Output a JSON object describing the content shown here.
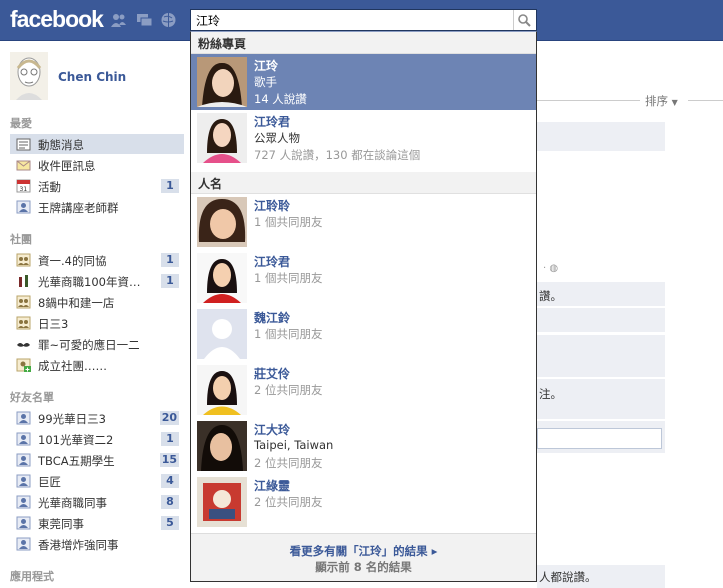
{
  "brand": {
    "logo": "facebook",
    "color": "#3b5998"
  },
  "topbar_icons": [
    "friend-requests-icon",
    "messages-icon",
    "notifications-icon"
  ],
  "search": {
    "value": "江玲",
    "icon": "search-icon"
  },
  "profile": {
    "name": "Chen Chin"
  },
  "sections": {
    "favorites": "最愛",
    "groups": "社團",
    "friend_lists": "好友名單",
    "apps": "應用程式"
  },
  "favorites": [
    {
      "label": "動態消息",
      "icon": "news-feed-icon",
      "count": ""
    },
    {
      "label": "收件匣訊息",
      "icon": "messages-icon",
      "count": ""
    },
    {
      "label": "活動",
      "icon": "calendar-icon",
      "count": "1"
    },
    {
      "label": "王牌講座老師群",
      "icon": "person-icon",
      "count": ""
    }
  ],
  "groups": [
    {
      "label": "資一.4的同協",
      "icon": "group-icon",
      "count": "1"
    },
    {
      "label": "光華商職100年資…",
      "icon": "wine-icon",
      "count": "1"
    },
    {
      "label": "8鍋中和建一店",
      "icon": "group-icon",
      "count": ""
    },
    {
      "label": "日三3",
      "icon": "group-icon",
      "count": ""
    },
    {
      "label": "罪~可愛的應日一二",
      "icon": "mustache-icon",
      "count": ""
    },
    {
      "label": "成立社團……",
      "icon": "add-group-icon",
      "count": ""
    }
  ],
  "friend_lists": [
    {
      "label": "99光華日三3",
      "icon": "person-icon",
      "count": "20"
    },
    {
      "label": "101光華資二2",
      "icon": "person-icon",
      "count": "1"
    },
    {
      "label": "TBCA五期學生",
      "icon": "person-icon",
      "count": "15"
    },
    {
      "label": "巨匠",
      "icon": "person-icon",
      "count": "4"
    },
    {
      "label": "光華商職同事",
      "icon": "person-icon",
      "count": "8"
    },
    {
      "label": "東莞同事",
      "icon": "person-icon",
      "count": "5"
    },
    {
      "label": "香港增炸強同事",
      "icon": "person-icon",
      "count": ""
    }
  ],
  "right_panel": {
    "sort_label": "排序",
    "text_1": "讚。",
    "text_2": "注。",
    "text_3": "人都說讚。"
  },
  "dropdown": {
    "pages_header": "粉絲專頁",
    "people_header": "人名",
    "pages": [
      {
        "name": "江玲",
        "line2": "歌手",
        "line3": "14 人說讚",
        "selected": true
      },
      {
        "name": "江玲君",
        "line2": "公眾人物",
        "line3": "727 人說讚，130 都在談論這個",
        "selected": false
      }
    ],
    "people": [
      {
        "name": "江聆聆",
        "line2": "",
        "line3": "1 個共同朋友"
      },
      {
        "name": "江玲君",
        "line2": "",
        "line3": "1 個共同朋友"
      },
      {
        "name": "魏江鈴",
        "line2": "",
        "line3": "1 個共同朋友"
      },
      {
        "name": "莊艾伶",
        "line2": "",
        "line3": "2 位共同朋友"
      },
      {
        "name": "江大玲",
        "line2": "Taipei, Taiwan",
        "line3": "2 位共同朋友"
      },
      {
        "name": "江綠靈",
        "line2": "",
        "line3": "2 位共同朋友"
      }
    ],
    "see_more": "看更多有關「江玲」的結果 ▸",
    "showing": "顯示前 8 名的結果"
  }
}
